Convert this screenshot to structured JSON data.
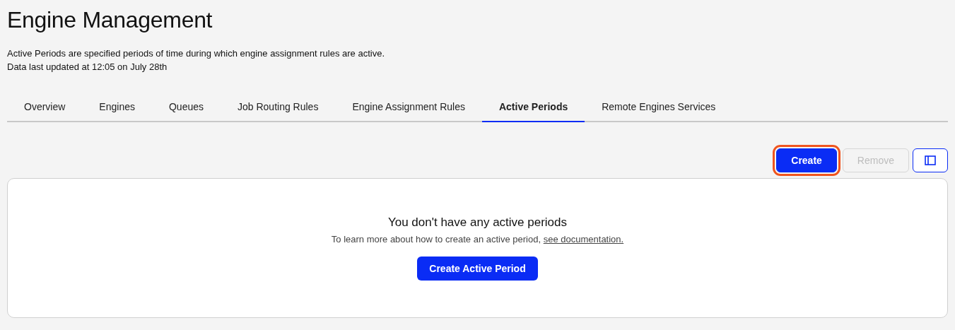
{
  "header": {
    "title": "Engine Management",
    "description": "Active Periods are specified periods of time during which engine assignment rules are active.",
    "updated": "Data last updated at 12:05 on July 28th"
  },
  "tabs": [
    {
      "label": "Overview",
      "selected": false
    },
    {
      "label": "Engines",
      "selected": false
    },
    {
      "label": "Queues",
      "selected": false
    },
    {
      "label": "Job Routing Rules",
      "selected": false
    },
    {
      "label": "Engine Assignment Rules",
      "selected": false
    },
    {
      "label": "Active Periods",
      "selected": true
    },
    {
      "label": "Remote Engines Services",
      "selected": false
    }
  ],
  "toolbar": {
    "buttons": [
      {
        "label": "Create",
        "disabled": false,
        "highlighted": true
      },
      {
        "label": "Remove",
        "disabled": true,
        "highlighted": false
      }
    ]
  },
  "empty_state": {
    "heading": "You don't have any active periods",
    "text": "To learn more about how to create an active period,",
    "link": "see documentation.",
    "button": "Create Active Period"
  }
}
